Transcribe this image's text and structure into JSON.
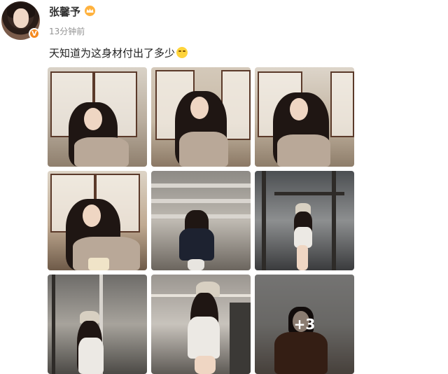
{
  "post": {
    "username": "张馨予",
    "timestamp": "13分钟前",
    "text": "天知道为这身材付出了多少",
    "emoji": "drooling-face-emoji",
    "more_count_label": "+3"
  },
  "colors": {
    "username": "#333333",
    "timestamp": "#939393",
    "verified_badge": "#f58a1f"
  },
  "icons": [
    "verified-v-icon",
    "crown-icon"
  ]
}
